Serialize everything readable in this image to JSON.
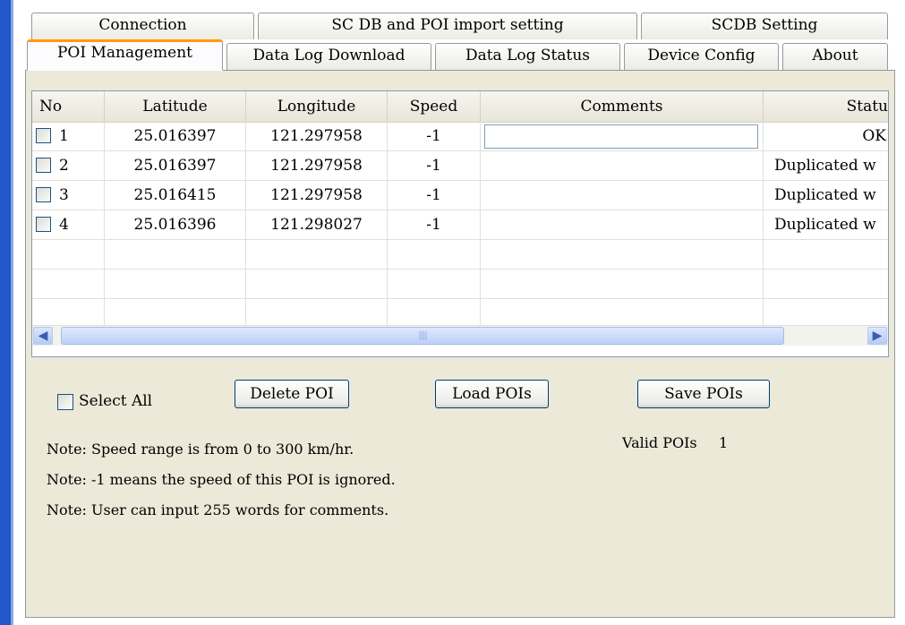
{
  "tabs_row1": [
    {
      "label": "Connection"
    },
    {
      "label": "SC DB and POI import setting"
    },
    {
      "label": "SCDB  Setting"
    }
  ],
  "tabs_row2": [
    {
      "label": "POI Management",
      "active": true
    },
    {
      "label": "Data Log Download"
    },
    {
      "label": "Data Log Status"
    },
    {
      "label": "Device Config"
    },
    {
      "label": "About"
    }
  ],
  "grid": {
    "columns": [
      "No",
      "Latitude",
      "Longitude",
      "Speed",
      "Comments",
      "Statu"
    ],
    "rows": [
      {
        "no": "1",
        "lat": "25.016397",
        "lon": "121.297958",
        "speed": "-1",
        "comment": "",
        "status": "OK"
      },
      {
        "no": "2",
        "lat": "25.016397",
        "lon": "121.297958",
        "speed": "-1",
        "comment": "",
        "status": "Duplicated w"
      },
      {
        "no": "3",
        "lat": "25.016415",
        "lon": "121.297958",
        "speed": "-1",
        "comment": "",
        "status": "Duplicated w"
      },
      {
        "no": "4",
        "lat": "25.016396",
        "lon": "121.298027",
        "speed": "-1",
        "comment": "",
        "status": "Duplicated w"
      }
    ]
  },
  "controls": {
    "select_all": "Select All",
    "delete_poi": "Delete POI",
    "load_pois": "Load POIs",
    "save_pois": "Save POIs",
    "valid_pois_label": "Valid POIs",
    "valid_pois_count": "1"
  },
  "notes": [
    "Note: Speed range is from 0 to 300 km/hr.",
    "Note: -1 means the speed of this POI is ignored.",
    "Note:  User can input 255 words for comments."
  ],
  "colors": {
    "active_tab_accent": "#ff9c00",
    "xp_blue": "#2257c9"
  }
}
